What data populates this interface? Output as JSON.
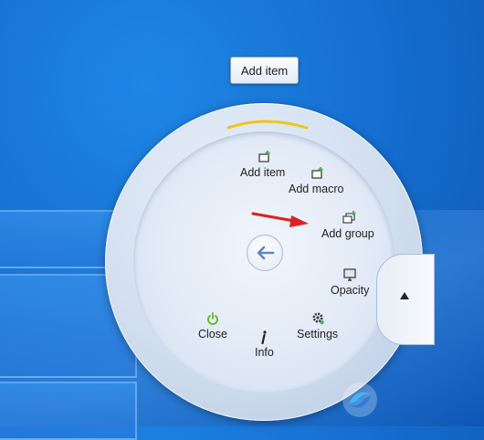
{
  "tooltip": {
    "label": "Add item"
  },
  "menu": {
    "items": [
      {
        "key": "add_item",
        "label": "Add item",
        "icon": "add-item-icon"
      },
      {
        "key": "add_macro",
        "label": "Add macro",
        "icon": "add-macro-icon"
      },
      {
        "key": "add_group",
        "label": "Add group",
        "icon": "add-group-icon"
      },
      {
        "key": "opacity",
        "label": "Opacity",
        "icon": "monitor-icon"
      },
      {
        "key": "settings",
        "label": "Settings",
        "icon": "gear-icon"
      },
      {
        "key": "info",
        "label": "Info",
        "icon": "info-icon"
      },
      {
        "key": "close",
        "label": "Close",
        "icon": "power-icon"
      }
    ],
    "back_icon": "back-arrow-icon",
    "expand_icon": "triangle-up-icon"
  },
  "colors": {
    "desktop": "#1670d2",
    "ring": "#cfdcee",
    "arc_accent": "#f0c419",
    "add_plus": "#4caf50",
    "close_icon": "#66b32e",
    "pointer_arrow": "#e02020",
    "back_arrow": "#5a88c6"
  }
}
